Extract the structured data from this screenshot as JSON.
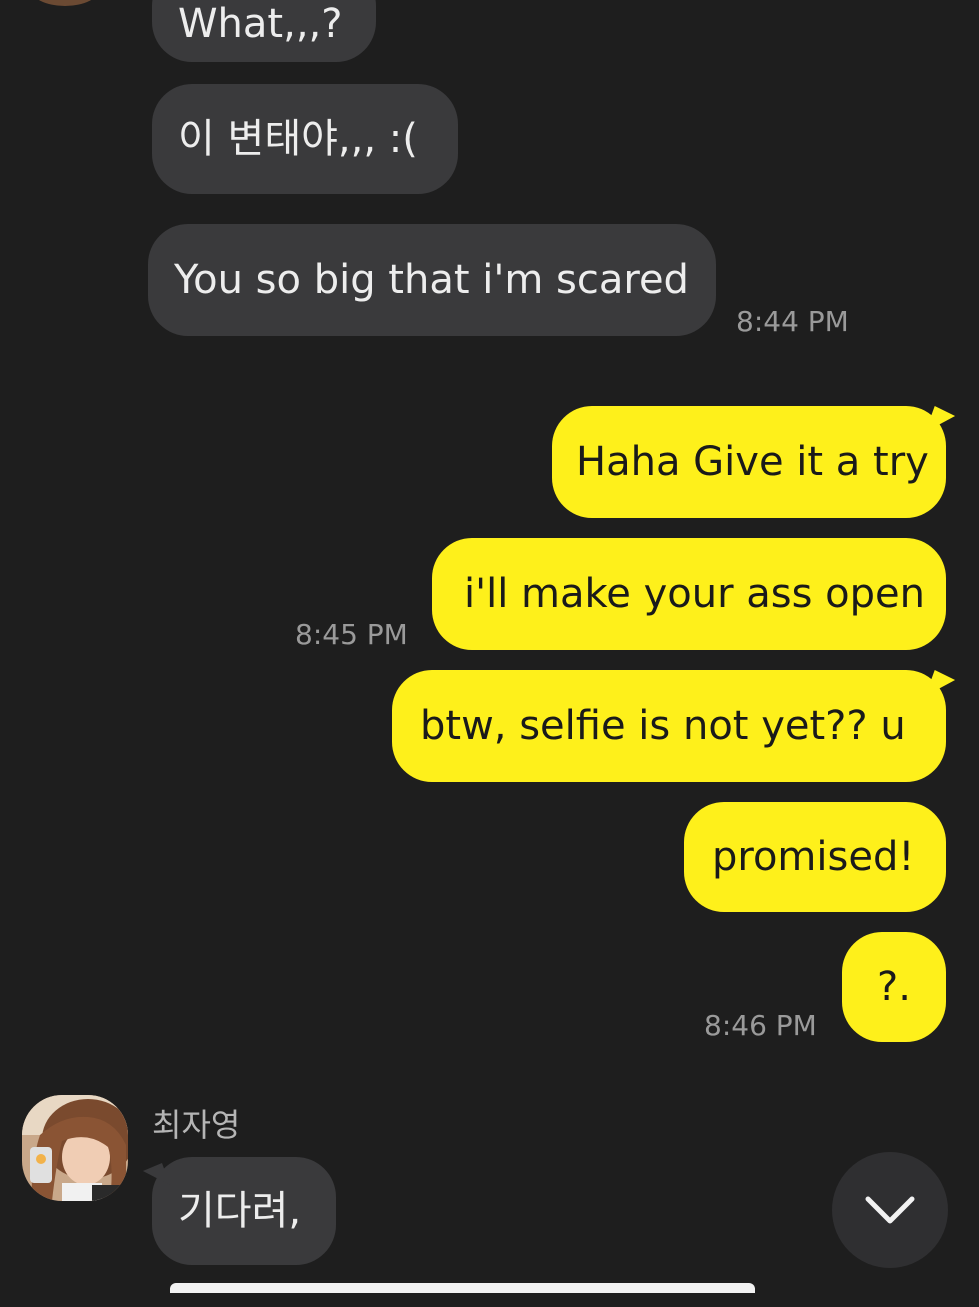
{
  "contact": {
    "name": "최자영"
  },
  "messages": {
    "in_1": "What,,,?",
    "in_2": "이 변태야,,, :(",
    "in_3": "You so big that i'm scared",
    "out_1": "Haha Give it a try",
    "out_2": "i'll make your ass open",
    "out_3": "btw, selfie is not yet?? u",
    "out_4": "promised!",
    "out_5": "?.",
    "in_4": "기다려,"
  },
  "times": {
    "t1": "8:44 PM",
    "t2": "8:45 PM",
    "t3": "8:46 PM"
  },
  "colors": {
    "background": "#1e1e1e",
    "incoming_bubble": "#3a3a3c",
    "outgoing_bubble": "#fef01b",
    "timestamp": "#9a9a9a"
  },
  "icons": {
    "scroll_down": "chevron-down-icon"
  }
}
